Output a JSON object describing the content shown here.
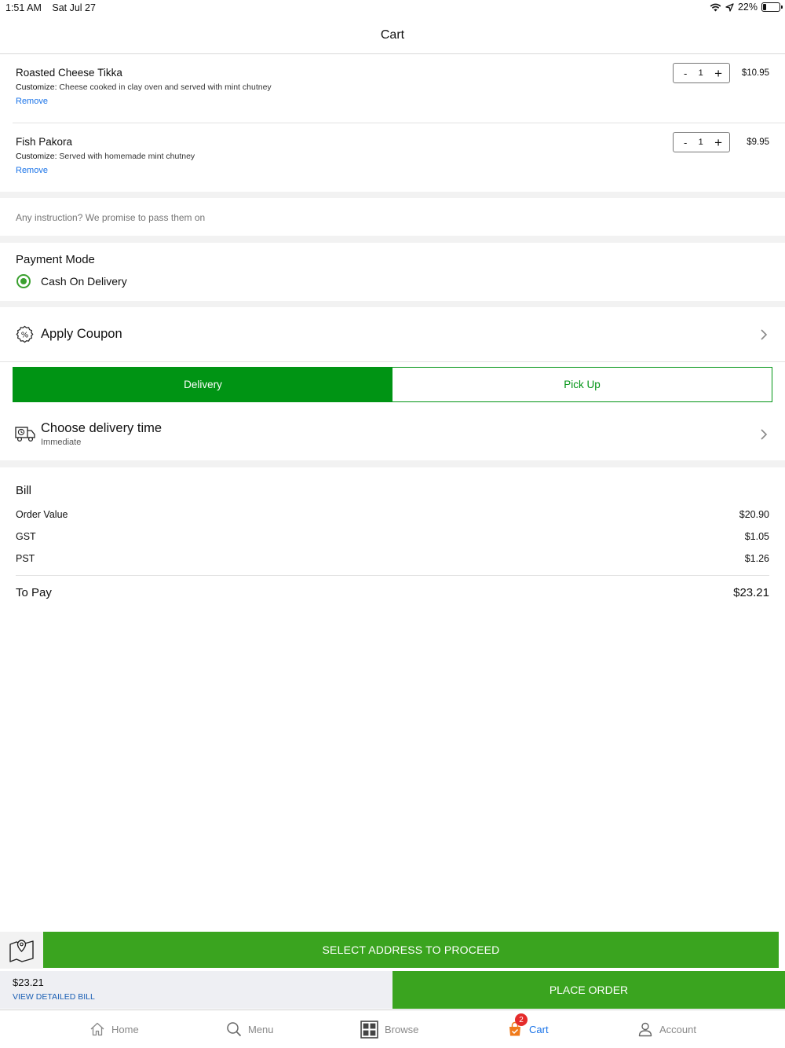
{
  "status_bar": {
    "time": "1:51 AM",
    "date": "Sat Jul 27",
    "battery": "22%",
    "battery_level": 0.22
  },
  "header": {
    "title": "Cart"
  },
  "cart": {
    "items": [
      {
        "name": "Roasted Cheese Tikka",
        "customize_label": "Customize:",
        "customize_text": " Cheese cooked in clay oven and served with mint chutney",
        "remove_label": "Remove",
        "minus": "-",
        "qty": "1",
        "plus": "+",
        "price": "$10.95"
      },
      {
        "name": "Fish Pakora",
        "customize_label": "Customize:",
        "customize_text": " Served with homemade mint chutney",
        "remove_label": "Remove",
        "minus": "-",
        "qty": "1",
        "plus": "+",
        "price": "$9.95"
      }
    ]
  },
  "instructions": {
    "placeholder": "Any instruction? We promise to pass them on"
  },
  "payment": {
    "title": "Payment Mode",
    "option": "Cash On Delivery"
  },
  "coupon": {
    "label": "Apply Coupon"
  },
  "order_type": {
    "delivery": "Delivery",
    "pickup": "Pick Up"
  },
  "delivery_time": {
    "title": "Choose delivery time",
    "value": "Immediate"
  },
  "bill": {
    "title": "Bill",
    "rows": [
      {
        "label": "Order Value",
        "value": "$20.90"
      },
      {
        "label": "GST",
        "value": "$1.05"
      },
      {
        "label": "PST",
        "value": "$1.26"
      }
    ],
    "total_label": "To Pay",
    "total_value": "$23.21"
  },
  "actions": {
    "select_address": "SELECT ADDRESS TO PROCEED",
    "amount": "$23.21",
    "view_bill": "VIEW DETAILED BILL",
    "place_order": "PLACE ORDER"
  },
  "tabbar": {
    "home": "Home",
    "menu": "Menu",
    "browse": "Browse",
    "cart": "Cart",
    "cart_badge": "2",
    "account": "Account"
  },
  "colors": {
    "primary_green": "#009414",
    "action_green": "#3aa41f",
    "link_blue": "#1a73e8",
    "badge_red": "#e52b2b"
  }
}
